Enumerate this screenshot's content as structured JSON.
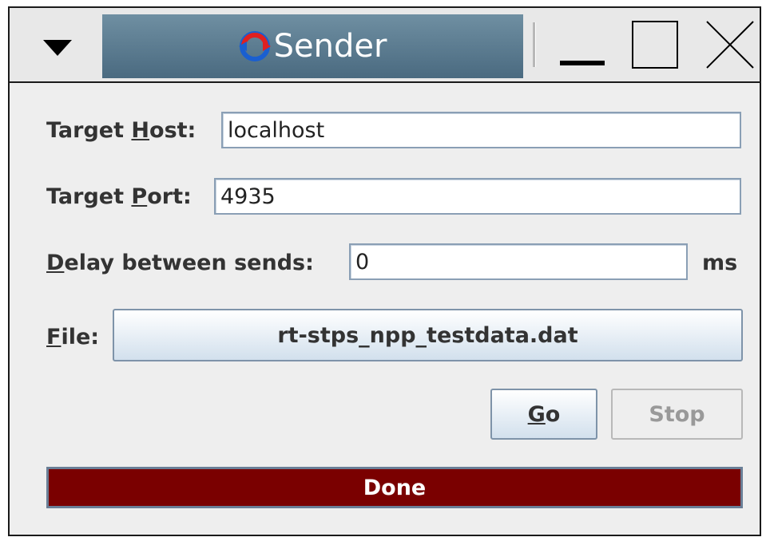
{
  "window": {
    "title": "Sender",
    "menu_icon": "triangle-down-icon",
    "app_icon": "sender-arrows-icon",
    "minimize_icon": "minimize-icon",
    "maximize_icon": "maximize-icon",
    "close_icon": "close-icon"
  },
  "form": {
    "host": {
      "label_mnemonic": "H",
      "label_after": "ost:",
      "label_before": "Target ",
      "value": "localhost"
    },
    "port": {
      "label_before": "Target ",
      "label_mnemonic": "P",
      "label_after": "ort:",
      "value": "4935"
    },
    "delay": {
      "label_mnemonic": "D",
      "label_after": "elay between sends:",
      "value": "0",
      "unit": "ms"
    },
    "file": {
      "label_mnemonic": "F",
      "label_after": "ile:",
      "button_label": "rt-stps_npp_testdata.dat"
    }
  },
  "buttons": {
    "go_mnemonic": "G",
    "go_rest": "o",
    "stop_label": "Stop"
  },
  "progress": {
    "text": "Done",
    "fraction": 1.0,
    "fill_color": "#7a0000"
  }
}
